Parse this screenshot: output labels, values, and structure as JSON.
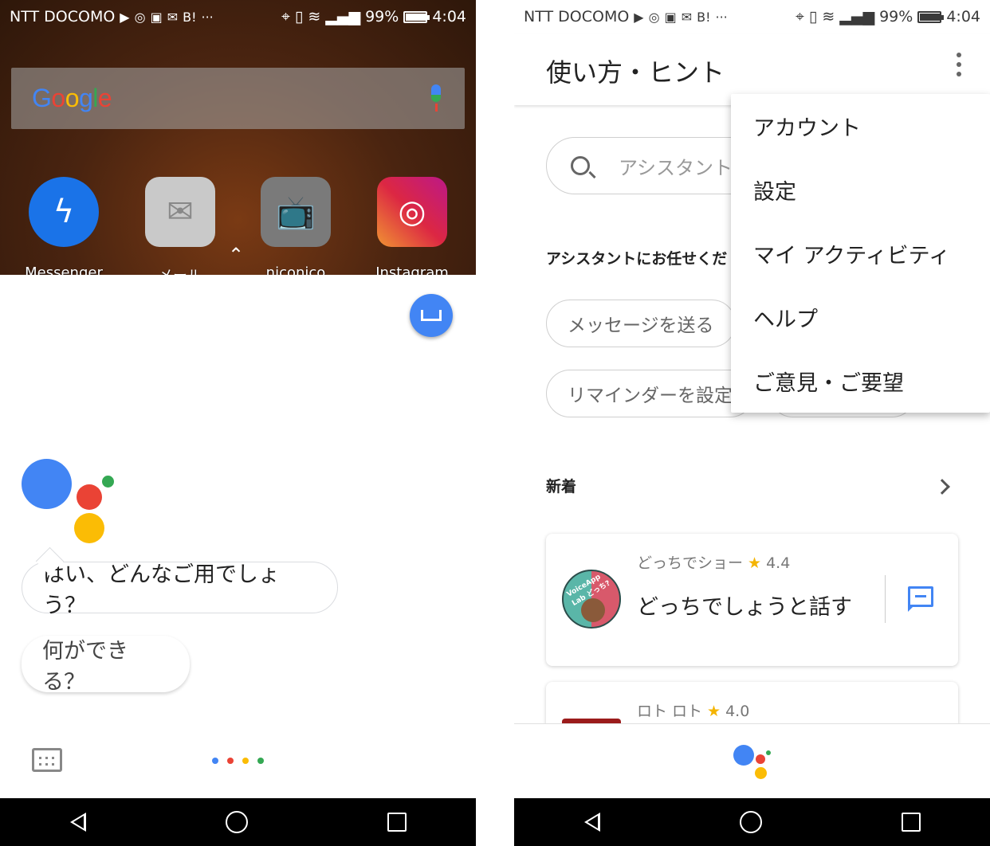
{
  "status_left": {
    "carrier": "NTT DOCOMO",
    "notif_icons": [
      "youtube-icon",
      "instagram-icon",
      "tv-icon",
      "mail-icon",
      "hatena-icon",
      "more-icon"
    ],
    "more": "···",
    "hatena": "B!",
    "signal_icons": [
      "location-icon",
      "vibrate-icon",
      "wifi-icon",
      "signal-icon"
    ],
    "battery_pct": "99%",
    "battery_level": 0.99,
    "time": "4:04"
  },
  "status_right": {
    "carrier": "NTT DOCOMO",
    "more": "···",
    "hatena": "B!",
    "battery_pct": "99%",
    "battery_level": 0.99,
    "time": "4:04"
  },
  "home": {
    "google_logo": "Google",
    "apps": [
      {
        "label": "Messenger",
        "icon": "messenger-icon",
        "color": "#1a73e8"
      },
      {
        "label": "メール",
        "icon": "mail-icon",
        "color": "#bdbdbd"
      },
      {
        "label": "niconico",
        "icon": "niconico-tv-icon",
        "color": "#777777"
      },
      {
        "label": "Instagram",
        "icon": "instagram-icon",
        "color": "#c13584"
      }
    ]
  },
  "assistant": {
    "response": "はい、どんなご用でしょう？",
    "suggestion": "何ができる？",
    "colors": {
      "blue": "#4285F4",
      "red": "#EA4335",
      "yellow": "#FBBC05",
      "green": "#34A853"
    }
  },
  "hints_page": {
    "title": "使い方・ヒント",
    "search_placeholder": "アシスタント",
    "section_tasks": "アシスタントにお任せくだ",
    "chips": [
      "メッセージを送る",
      "リマインダーを設定"
    ],
    "section_new": "新着",
    "cards": [
      {
        "name": "どっちでショー",
        "rating": "4.4",
        "action": "どっちでしょうと話す",
        "avatar_text": "VoiceApp Lab どっち?"
      },
      {
        "name": "ロト ロト",
        "rating": "4.0"
      }
    ]
  },
  "overflow_menu": {
    "items": [
      "アカウント",
      "設定",
      "マイ アクティビティ",
      "ヘルプ",
      "ご意見・ご要望"
    ]
  }
}
